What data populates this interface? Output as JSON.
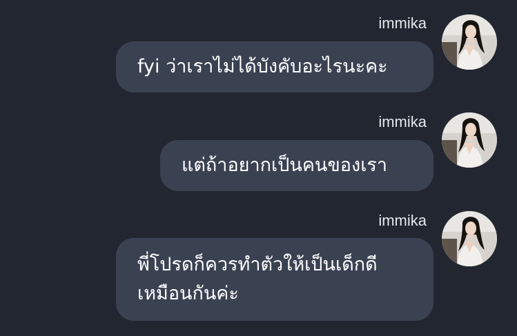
{
  "messages": [
    {
      "username": "immika",
      "text": "fyi ว่าเราไม่ได้บังคับอะไรนะคะ",
      "avatar": "profile-photo"
    },
    {
      "username": "immika",
      "text": "แต่ถ้าอยากเป็นคนของเรา",
      "avatar": "profile-photo"
    },
    {
      "username": "immika",
      "text": "พี่โปรดก็ควรทำตัวให้เป็นเด็กดี\nเหมือนกันค่ะ",
      "avatar": "profile-photo"
    }
  ],
  "colors": {
    "background": "#222630",
    "bubble": "#3a4252",
    "text": "#ffffff",
    "username": "#e6e8ee"
  }
}
